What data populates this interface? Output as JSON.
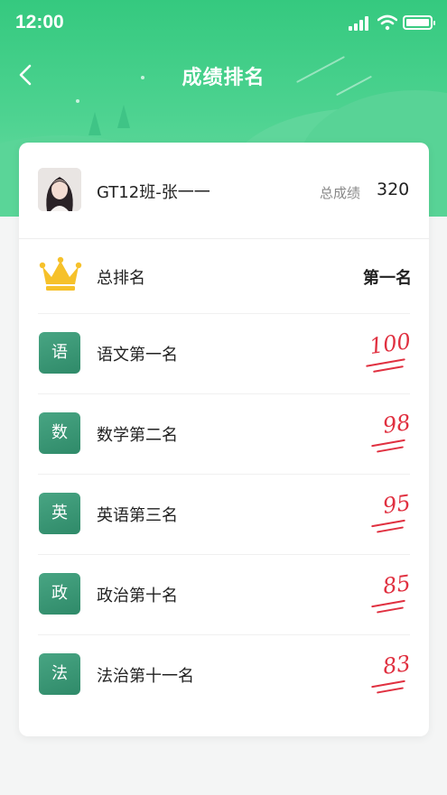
{
  "status_bar": {
    "time": "12:00"
  },
  "nav": {
    "title": "成绩排名"
  },
  "profile": {
    "name": "GT12班-张一一",
    "total_label": "总成绩",
    "total_value": "320"
  },
  "overall": {
    "label": "总排名",
    "value": "第一名"
  },
  "subjects": [
    {
      "icon_char": "语",
      "label": "语文第一名",
      "score": "100"
    },
    {
      "icon_char": "数",
      "label": "数学第二名",
      "score": "98"
    },
    {
      "icon_char": "英",
      "label": "英语第三名",
      "score": "95"
    },
    {
      "icon_char": "政",
      "label": "政治第十名",
      "score": "85"
    },
    {
      "icon_char": "法",
      "label": "法治第十一名",
      "score": "83"
    }
  ],
  "colors": {
    "header_green": "#35c97f",
    "subject_icon": "#3a9776",
    "score_red": "#e03040",
    "crown_gold": "#f6c12a"
  }
}
